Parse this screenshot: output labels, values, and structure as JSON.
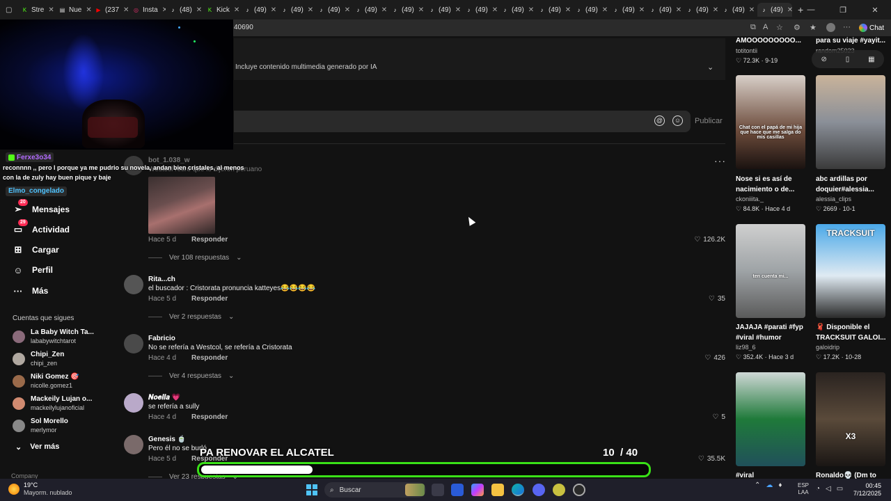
{
  "browser": {
    "tabs": [
      {
        "label": "Stre",
        "color": "#53fc18",
        "glyph": "K"
      },
      {
        "label": "Nue",
        "color": "#dddddd",
        "glyph": "▤"
      },
      {
        "label": "(237",
        "color": "#ff0000",
        "glyph": "▶"
      },
      {
        "label": "Insta",
        "color": "#e1306c",
        "glyph": "◎"
      },
      {
        "label": "(48)",
        "color": "#ffffff",
        "glyph": "♪"
      },
      {
        "label": "Kick",
        "color": "#53fc18",
        "glyph": "K"
      },
      {
        "label": "(49)",
        "color": "#ffffff",
        "glyph": "♪"
      },
      {
        "label": "(49)",
        "color": "#ffffff",
        "glyph": "♪"
      },
      {
        "label": "(49)",
        "color": "#ffffff",
        "glyph": "♪"
      },
      {
        "label": "(49)",
        "color": "#ffffff",
        "glyph": "♪"
      },
      {
        "label": "(49)",
        "color": "#ffffff",
        "glyph": "♪"
      },
      {
        "label": "(49)",
        "color": "#ffffff",
        "glyph": "♪"
      },
      {
        "label": "(49)",
        "color": "#ffffff",
        "glyph": "♪"
      },
      {
        "label": "(49)",
        "color": "#ffffff",
        "glyph": "♪"
      },
      {
        "label": "(49)",
        "color": "#ffffff",
        "glyph": "♪"
      },
      {
        "label": "(49)",
        "color": "#ffffff",
        "glyph": "♪"
      },
      {
        "label": "(49)",
        "color": "#ffffff",
        "glyph": "♪"
      },
      {
        "label": "(49)",
        "color": "#ffffff",
        "glyph": "♪"
      },
      {
        "label": "(49)",
        "color": "#ffffff",
        "glyph": "♪"
      },
      {
        "label": "(49)",
        "color": "#ffffff",
        "glyph": "♪"
      },
      {
        "label": "(49)",
        "color": "#ffffff",
        "glyph": "♪"
      }
    ],
    "url": "40690",
    "chat_label": "Chat",
    "new_tab": "+"
  },
  "post": {
    "ai_notice": "Incluye contenido multimedia generado por IA",
    "publish_label": "Publicar"
  },
  "overlay": {
    "chat_user1": "Ferxe3o34",
    "chat_message": "reconnnn ,, pero l porque ya me pudrio su novela, andan bien cristales, al menos con la de zuly hay buen pique y baje",
    "chat_user2": "Elmo_congelado",
    "progress_title": "PA RENOVAR EL ALCATEL",
    "progress_current": "10",
    "progress_total": "/ 40",
    "progress_fraction": 0.25,
    "accent_color": "#39e017"
  },
  "sidebar": {
    "items": [
      {
        "label": "Mensajes",
        "icon": "send-icon",
        "glyph": "➢",
        "badge": "20"
      },
      {
        "label": "Actividad",
        "icon": "inbox-icon",
        "glyph": "▭",
        "badge": "29"
      },
      {
        "label": "Cargar",
        "icon": "upload-icon",
        "glyph": "⊞",
        "badge": ""
      },
      {
        "label": "Perfil",
        "icon": "person-icon",
        "glyph": "☺",
        "badge": ""
      },
      {
        "label": "Más",
        "icon": "more-icon",
        "glyph": "···",
        "badge": ""
      }
    ],
    "following_title": "Cuentas que sigues",
    "following": [
      {
        "name": "La Baby Witch Ta...",
        "handle": "lababywitchtarot",
        "color": "#8a6a7a"
      },
      {
        "name": "Chipi_Zen",
        "handle": "chipi_zen",
        "color": "#b0a8a0"
      },
      {
        "name": "Niki Gomez 🎯",
        "handle": "nicolle.gomez1",
        "color": "#9a6a4a"
      },
      {
        "name": "Mackeily Lujan o...",
        "handle": "mackeilylujanoficial",
        "color": "#d08a70"
      },
      {
        "name": "Sol Morello",
        "handle": "merlymor",
        "color": "#888888"
      }
    ],
    "see_more": "Ver más",
    "company": "Company"
  },
  "comments": [
    {
      "name": "bot_1.038_w",
      "text": "Westcol retiró que lo dijeron peruano",
      "time": "Hace 5 d",
      "reply": "Responder",
      "likes": "126.2K",
      "replies": "Ver 108 respuestas",
      "avatar": "#3a3a3a"
    },
    {
      "name": "Rita...ch",
      "text": "el buscador : Cristorata pronuncia katteyes😂😂😂😂",
      "time": "Hace 5 d",
      "reply": "Responder",
      "likes": "35",
      "replies": "Ver 2 respuestas",
      "avatar": "#555555"
    },
    {
      "name": "Fabricio",
      "text": "No se refería a Westcol, se refería a Cristorata",
      "time": "Hace 4 d",
      "reply": "Responder",
      "likes": "426",
      "replies": "Ver 4 respuestas",
      "avatar": "#4a4a4a"
    },
    {
      "name": "𝑵𝒐𝒆𝒍𝒊𝒂 💗",
      "text": "se refería a sully",
      "time": "Hace 4 d",
      "reply": "Responder",
      "likes": "5",
      "replies": "",
      "avatar": "#b9a9c9"
    },
    {
      "name": "Genesis 🍵",
      "text": "Pero él no se burló",
      "time": "Hace 5 d",
      "reply": "Responder",
      "likes": "35.5K",
      "replies": "Ver 23 respuestas",
      "avatar": "#7a6a6a"
    }
  ],
  "videos": [
    {
      "title": "AMOOOOOOOOO...",
      "user": "totitontii",
      "stats": "♡ 72.3K · 9-19",
      "thumb": ""
    },
    {
      "title": "para su viaje #yayit...",
      "user": "random25023",
      "stats": "",
      "thumb": ""
    },
    {
      "title": "Nose si es así de nacimiento o de...",
      "user": "ckoniiita._",
      "stats": "♡ 84.8K · Hace 4 d",
      "thumb": "linear-gradient(180deg,#d8cfc8,#6b4a3a 60%,#1a1210)",
      "caption": "Chat con el papá de mi hija que hace que me salga do mis casillas"
    },
    {
      "title": "abc ardillas por doquier#alessia...",
      "user": "alessia_clips",
      "stats": "♡ 2669 · 10-1",
      "thumb": "linear-gradient(180deg,#c9b39a,#8a8f98 50%,#3a3a3a)"
    },
    {
      "title": "JAJAJA #parati #fyp #viral #humor",
      "user": "liz98_6",
      "stats": "♡ 352.4K · Hace 3 d",
      "thumb": "linear-gradient(180deg,#cfcfcf,#9ea3a6 50%,#5a5a5a)",
      "caption": "ten cuenta mi..."
    },
    {
      "title": "🧣 Disponible el TRACKSUIT GALOI...",
      "user": "galoidrip",
      "stats": "♡ 17.2K · 10-28",
      "thumb": "linear-gradient(180deg,#4aa8e8,#dfeaf2 55%,#2a2a2a)",
      "caption": "TRACKSUIT"
    },
    {
      "title": "#viral",
      "user": "",
      "stats": "",
      "thumb": "linear-gradient(180deg,#cfd8d6,#1f7a3a 50%,#20505a)"
    },
    {
      "title": "Ronaldo💀 (Dm to",
      "user": "",
      "stats": "",
      "thumb": "linear-gradient(180deg,#2a2320,#5a4a3a 50%,#1a1614)",
      "caption": "X3"
    }
  ],
  "taskbar": {
    "temp": "19°C",
    "weather": "Mayorm. nublado",
    "search": "Buscar",
    "lang1": "ESP",
    "lang2": "LAA",
    "time": "00:45",
    "date": "7/12/2025"
  }
}
